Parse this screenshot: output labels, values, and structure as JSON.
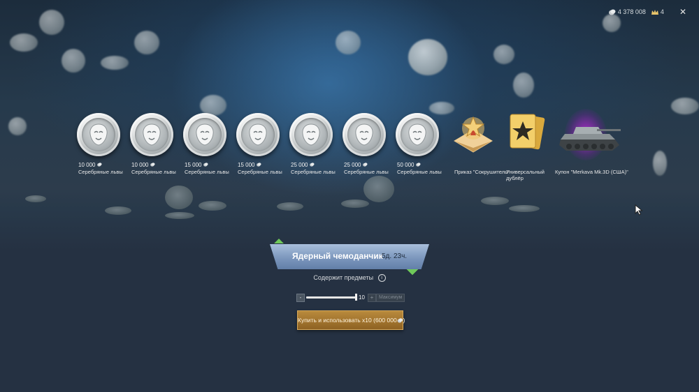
{
  "topbar": {
    "silver": "4 378 008",
    "gold": "4",
    "close": "✕"
  },
  "rewards": [
    {
      "amount": "10 000",
      "title": "Серебряные львы",
      "icon": "silver-lion-coin"
    },
    {
      "amount": "10 000",
      "title": "Серебряные львы",
      "icon": "silver-lion-coin"
    },
    {
      "amount": "15 000",
      "title": "Серебряные львы",
      "icon": "silver-lion-coin"
    },
    {
      "amount": "15 000",
      "title": "Серебряные львы",
      "icon": "silver-lion-coin"
    },
    {
      "amount": "25 000",
      "title": "Серебряные львы",
      "icon": "silver-lion-coin"
    },
    {
      "amount": "25 000",
      "title": "Серебряные львы",
      "icon": "silver-lion-coin"
    },
    {
      "amount": "50 000",
      "title": "Серебряные львы",
      "icon": "silver-lion-coin"
    },
    {
      "title": "Приказ \"Сокрушитель\"",
      "icon": "order-icon"
    },
    {
      "title": "Универсальный дублёр",
      "icon": "universal-backup-icon"
    },
    {
      "title": "Купон \"Merkava Mk.3D (США)\"",
      "icon": "tank-coupon-icon"
    }
  ],
  "banner": {
    "name": "Ядерный чемоданчик",
    "timer": "5д. 23ч."
  },
  "contains_label": "Содержит предметы",
  "info_icon": "i",
  "quantity": {
    "minus": "-",
    "value": "10",
    "plus": "+",
    "max_label": "Максимум"
  },
  "buy_button": "Купить и использовать x10 (600 000",
  "buy_button_tail": ")",
  "colors": {
    "accent_green": "#6fc95a",
    "banner": "#8aa4c8",
    "buy_button": "#a3762f",
    "tank_glow": "#c828e6"
  }
}
